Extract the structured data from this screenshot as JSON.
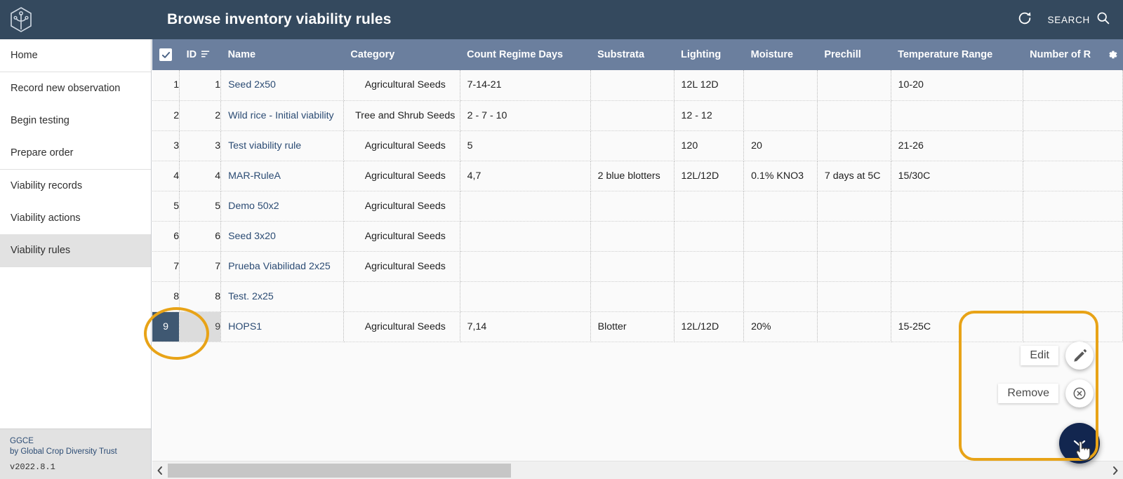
{
  "header": {
    "title": "Browse inventory viability rules",
    "logo_icon": "hexagon-sprout-logo",
    "refresh_icon": "refresh-icon",
    "search_label": "SEARCH",
    "search_icon": "search-icon",
    "bg_color": "#34495e"
  },
  "sidebar": {
    "groups": [
      {
        "items": [
          {
            "label": "Home",
            "active": false
          }
        ]
      },
      {
        "items": [
          {
            "label": "Record new observation",
            "active": false
          },
          {
            "label": "Begin testing",
            "active": false
          },
          {
            "label": "Prepare order",
            "active": false
          }
        ]
      },
      {
        "items": [
          {
            "label": "Viability records",
            "active": false
          },
          {
            "label": "Viability actions",
            "active": false
          },
          {
            "label": "Viability rules",
            "active": true
          }
        ]
      }
    ],
    "footer": {
      "brand": "GGCE",
      "by_line": "by Global Crop Diversity Trust",
      "version": "v2022.8.1"
    }
  },
  "table": {
    "select_all_icon": "checkbox-checked-icon",
    "sort_icon": "sort-icon",
    "settings_icon": "gear-icon",
    "header_bg": "#6b7f9e",
    "selected_row_bg": "#d9e0f5",
    "columns": [
      "ID",
      "Name",
      "Category",
      "Count Regime Days",
      "Substrata",
      "Lighting",
      "Moisture",
      "Prechill",
      "Temperature Range",
      "Number of R"
    ],
    "rows": [
      {
        "num": "1",
        "id": "1",
        "name": "Seed 2x50",
        "category": "Agricultural Seeds",
        "count_regime_days": "7-14-21",
        "substrata": "",
        "lighting": "12L 12D",
        "moisture": "",
        "prechill": "",
        "temperature_range": "10-20",
        "number_of_rep": "",
        "selected": false
      },
      {
        "num": "2",
        "id": "2",
        "name": "Wild rice - Initial viability",
        "category": "Tree and Shrub Seeds",
        "count_regime_days": "2 - 7 - 10",
        "substrata": "",
        "lighting": "12 - 12",
        "moisture": "",
        "prechill": "",
        "temperature_range": "",
        "number_of_rep": "",
        "selected": false
      },
      {
        "num": "3",
        "id": "3",
        "name": "Test viability rule",
        "category": "Agricultural Seeds",
        "count_regime_days": "5",
        "substrata": "",
        "lighting": "120",
        "moisture": "20",
        "prechill": "",
        "temperature_range": "21-26",
        "number_of_rep": "",
        "selected": false
      },
      {
        "num": "4",
        "id": "4",
        "name": "MAR-RuleA",
        "category": "Agricultural Seeds",
        "count_regime_days": "4,7",
        "substrata": "2 blue blotters",
        "lighting": "12L/12D",
        "moisture": "0.1% KNO3",
        "prechill": "7 days at 5C",
        "temperature_range": "15/30C",
        "number_of_rep": "",
        "selected": false
      },
      {
        "num": "5",
        "id": "5",
        "name": "Demo 50x2",
        "category": "Agricultural Seeds",
        "count_regime_days": "",
        "substrata": "",
        "lighting": "",
        "moisture": "",
        "prechill": "",
        "temperature_range": "",
        "number_of_rep": "",
        "selected": false
      },
      {
        "num": "6",
        "id": "6",
        "name": "Seed 3x20",
        "category": "Agricultural Seeds",
        "count_regime_days": "",
        "substrata": "",
        "lighting": "",
        "moisture": "",
        "prechill": "",
        "temperature_range": "",
        "number_of_rep": "",
        "selected": false
      },
      {
        "num": "7",
        "id": "7",
        "name": "Prueba Viabilidad 2x25",
        "category": "Agricultural Seeds",
        "count_regime_days": "",
        "substrata": "",
        "lighting": "",
        "moisture": "",
        "prechill": "",
        "temperature_range": "",
        "number_of_rep": "",
        "selected": false
      },
      {
        "num": "8",
        "id": "8",
        "name": "Test. 2x25",
        "category": "",
        "count_regime_days": "",
        "substrata": "",
        "lighting": "",
        "moisture": "",
        "prechill": "",
        "temperature_range": "",
        "number_of_rep": "",
        "selected": false
      },
      {
        "num": "9",
        "id": "9",
        "name": "HOPS1",
        "category": "Agricultural Seeds",
        "count_regime_days": "7,14",
        "substrata": "Blotter",
        "lighting": "12L/12D",
        "moisture": "20%",
        "prechill": "",
        "temperature_range": "15-25C",
        "number_of_rep": "",
        "selected": true
      }
    ]
  },
  "fab": {
    "edit_label": "Edit",
    "edit_icon": "pencil-icon",
    "remove_label": "Remove",
    "remove_icon": "circle-x-icon",
    "main_icon": "chevron-down-icon",
    "main_color": "#12264f",
    "cursor_icon": "pointer-cursor-icon"
  },
  "annotations": {
    "highlight_color": "#e8a317",
    "shapes": [
      "ellipse-around-row-9-number",
      "rounded-rect-around-fab-cluster"
    ]
  },
  "scrollbar": {
    "left_arrow_icon": "chevron-left-icon",
    "right_arrow_icon": "chevron-right-icon"
  }
}
